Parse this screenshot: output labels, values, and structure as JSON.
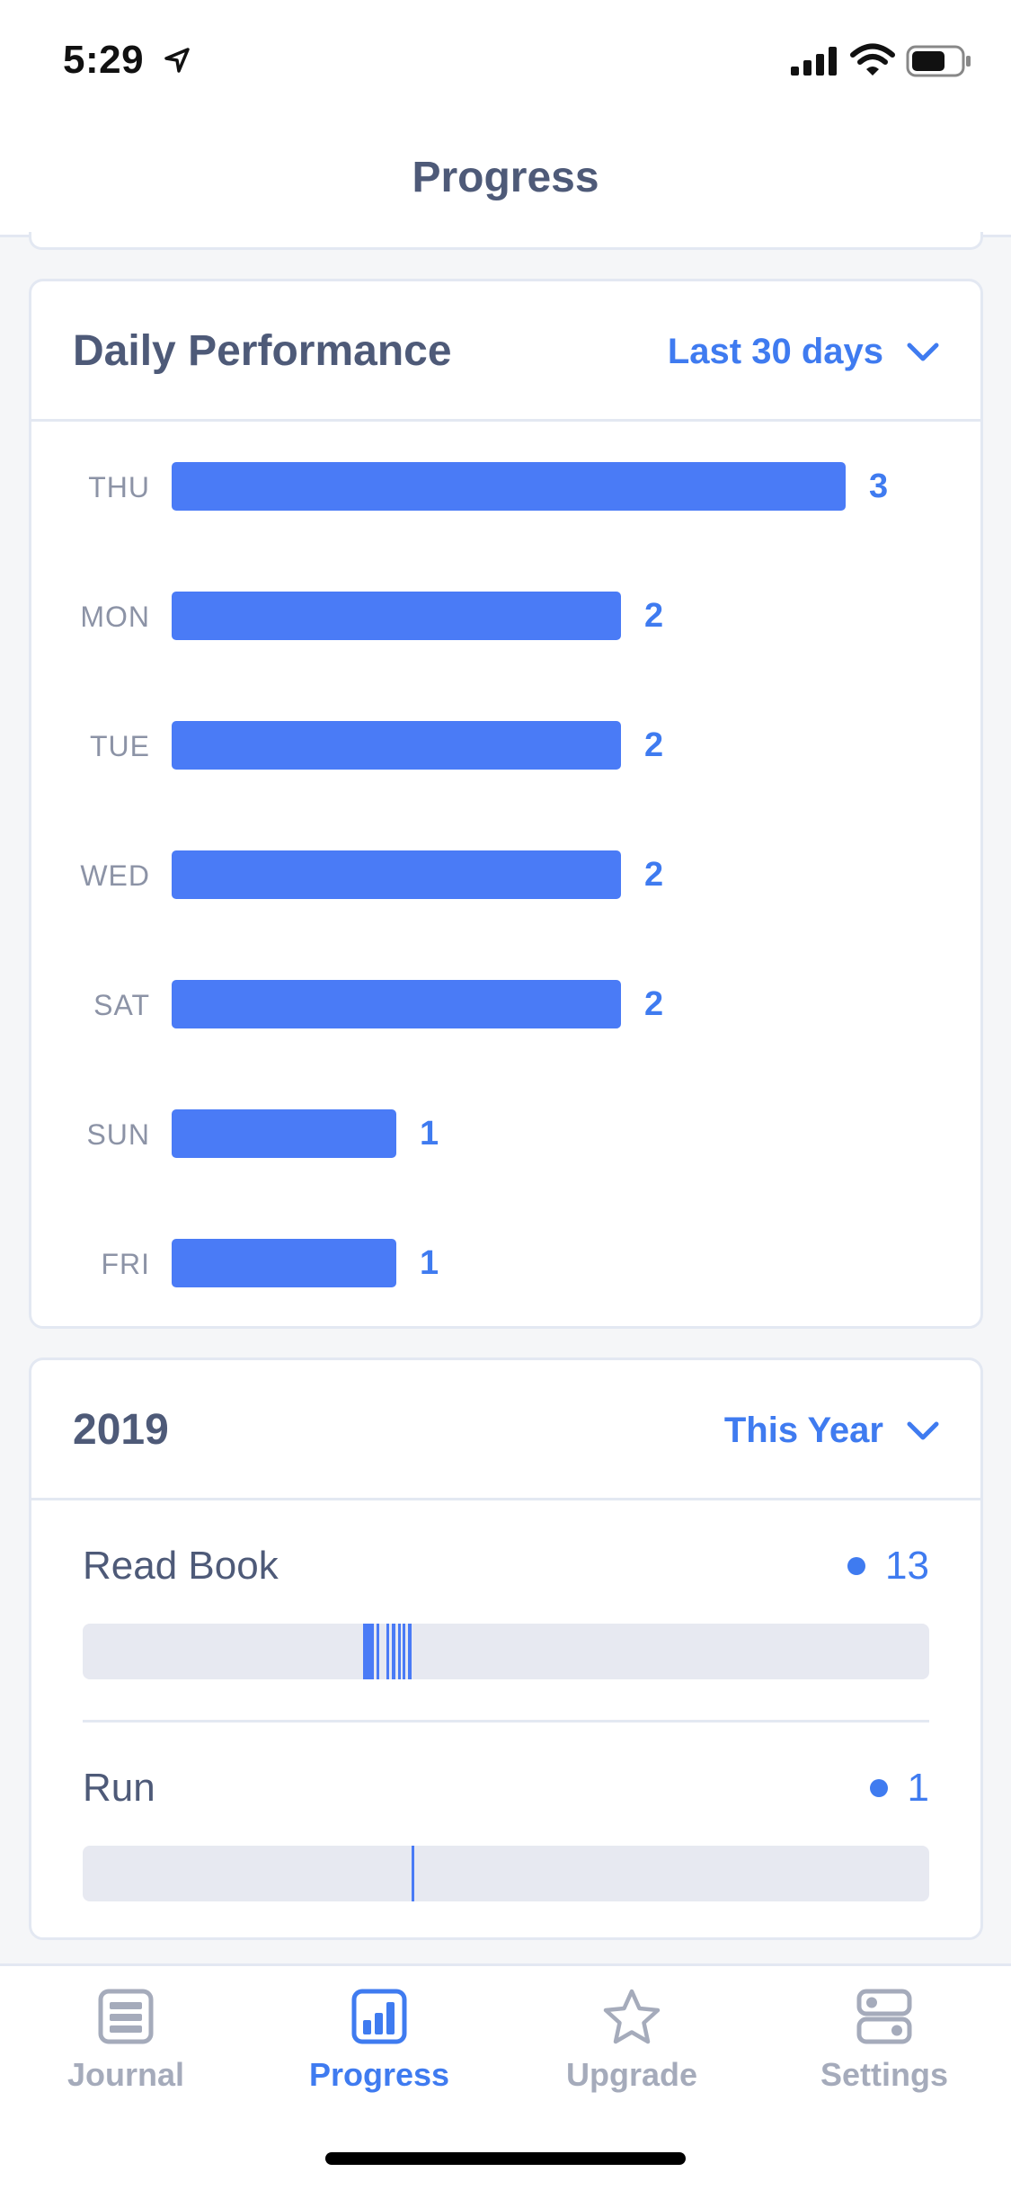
{
  "status_bar": {
    "time": "5:29"
  },
  "nav": {
    "title": "Progress"
  },
  "daily_performance": {
    "title": "Daily Performance",
    "range": "Last 30 days",
    "max_value": 3
  },
  "chart_data": {
    "type": "bar",
    "orientation": "horizontal",
    "categories": [
      "THU",
      "MON",
      "TUE",
      "WED",
      "SAT",
      "SUN",
      "FRI"
    ],
    "values": [
      3,
      2,
      2,
      2,
      2,
      1,
      1
    ],
    "xlim": [
      0,
      3
    ]
  },
  "year_card": {
    "title": "2019",
    "range": "This Year",
    "habits": [
      {
        "name": "Read Book",
        "count": "13"
      },
      {
        "name": "Run",
        "count": "1"
      }
    ]
  },
  "tabs": [
    {
      "label": "Journal",
      "icon": "journal-icon",
      "active": false
    },
    {
      "label": "Progress",
      "icon": "progress-chart-icon",
      "active": true
    },
    {
      "label": "Upgrade",
      "icon": "star-icon",
      "active": false
    },
    {
      "label": "Settings",
      "icon": "settings-icon",
      "active": false
    }
  ],
  "colors": {
    "accent": "#3f7bf0",
    "bar": "#4a7bf6",
    "text": "#4e5a78",
    "muted": "#a5abbb"
  }
}
